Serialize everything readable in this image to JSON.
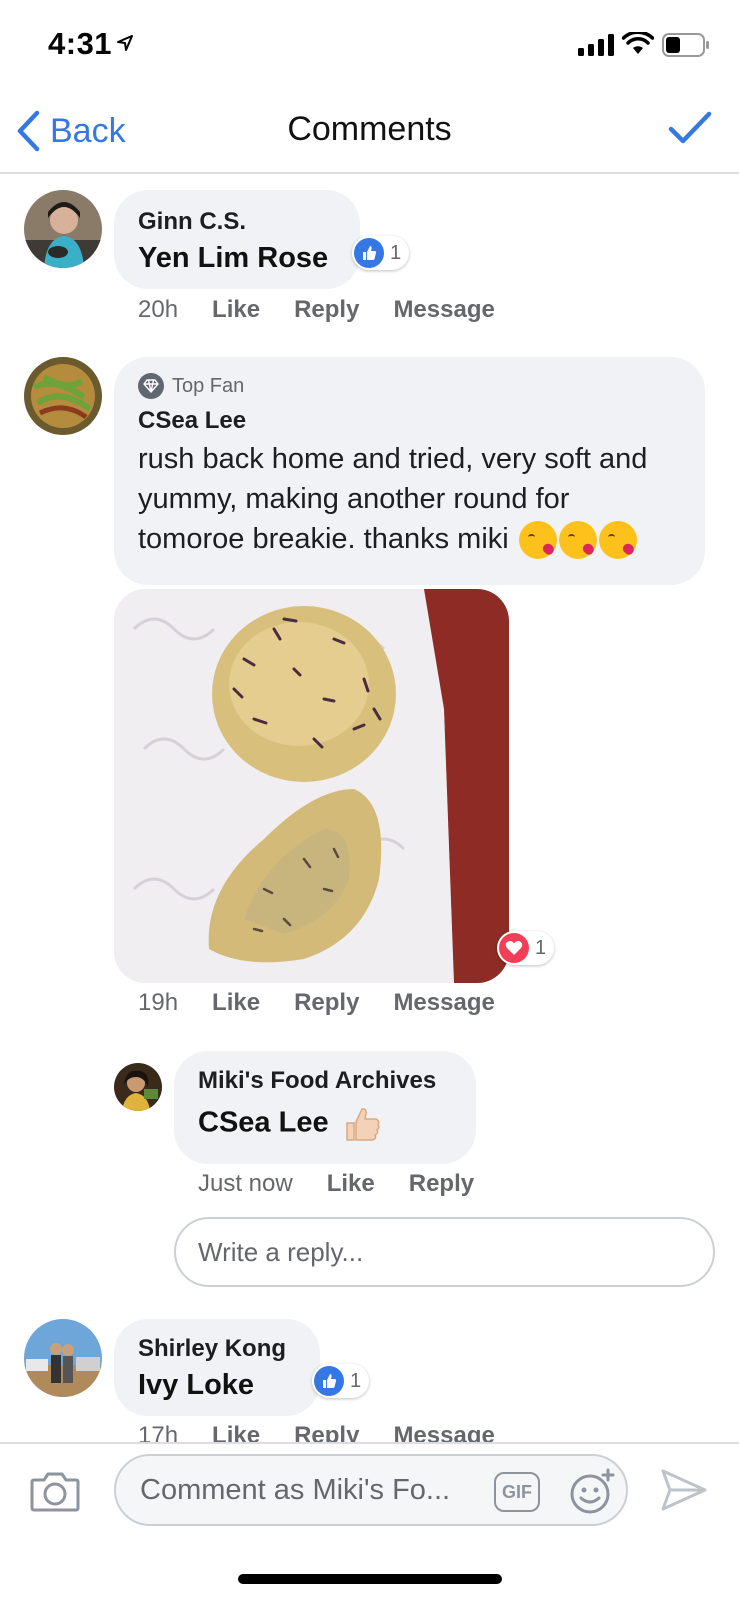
{
  "status_bar": {
    "time": "4:31"
  },
  "nav": {
    "back_label": "Back",
    "title": "Comments"
  },
  "comments": [
    {
      "author": "Ginn C.S.",
      "text": "Yen Lim Rose",
      "reaction_count": "1",
      "reaction_type": "like",
      "time": "20h",
      "actions": [
        "Like",
        "Reply",
        "Message"
      ]
    },
    {
      "badge": "Top Fan",
      "author": "CSea Lee",
      "text": "rush back home and tried, very soft and yummy, making another round for tomoroe breakie. thanks miki",
      "emoji": "kissing-heart x3",
      "reaction_count": "1",
      "reaction_type": "love",
      "time": "19h",
      "actions": [
        "Like",
        "Reply",
        "Message"
      ],
      "reply": {
        "author": "Miki's Food Archives",
        "text": "CSea Lee",
        "emoji": "thumbs-up",
        "time": "Just now",
        "actions": [
          "Like",
          "Reply"
        ]
      }
    },
    {
      "author": "Shirley Kong",
      "text": "Ivy Loke",
      "reaction_count": "1",
      "reaction_type": "like",
      "time": "17h",
      "actions": [
        "Like",
        "Reply",
        "Message"
      ]
    }
  ],
  "reply_input": {
    "placeholder": "Write a reply..."
  },
  "composer": {
    "placeholder": "Comment as Miki's Fo...",
    "gif_label": "GIF"
  },
  "colors": {
    "accent": "#3578e5",
    "bubble": "#f0f2f5",
    "love": "#f33e58"
  }
}
